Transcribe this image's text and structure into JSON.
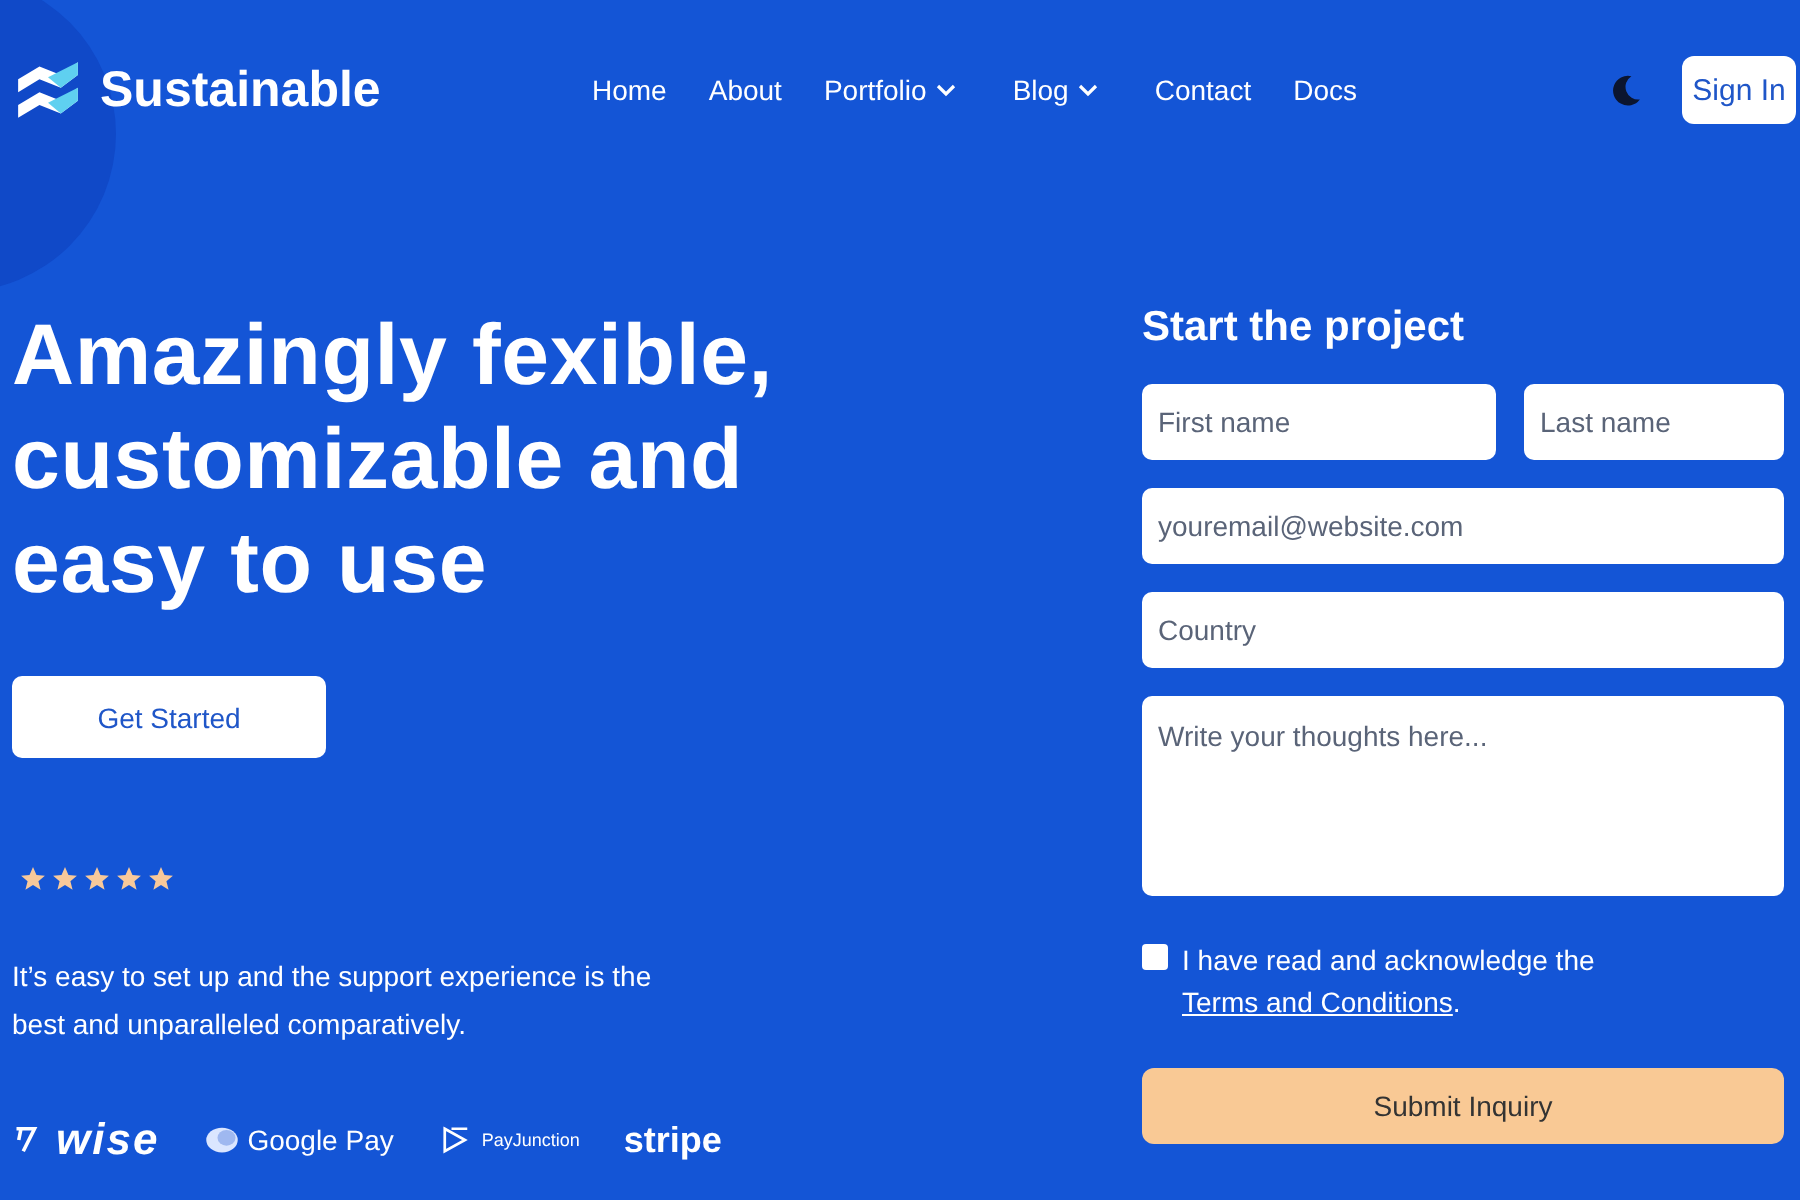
{
  "header": {
    "brand": "Sustainable",
    "nav": [
      {
        "label": "Home",
        "dropdown": false
      },
      {
        "label": "About",
        "dropdown": false
      },
      {
        "label": "Portfolio",
        "dropdown": true
      },
      {
        "label": "Blog",
        "dropdown": true
      },
      {
        "label": "Contact",
        "dropdown": false
      },
      {
        "label": "Docs",
        "dropdown": false
      }
    ],
    "sign_in": "Sign In"
  },
  "hero": {
    "title_lines": [
      "Amazingly fexible,",
      "customizable and",
      "easy to use"
    ],
    "cta": "Get Started",
    "stars": 5,
    "testimonial": "It’s easy to set up and the support experience is the best and unparalleled comparatively.",
    "logos": [
      {
        "kind": "wise",
        "text": "wise"
      },
      {
        "kind": "googlepay",
        "text": "Google Pay"
      },
      {
        "kind": "payjunction",
        "text": "PayJunction"
      },
      {
        "kind": "stripe",
        "text": "stripe"
      }
    ]
  },
  "form": {
    "title": "Start the project",
    "first_name": {
      "placeholder": "First name"
    },
    "last_name": {
      "placeholder": "Last name"
    },
    "email": {
      "placeholder": "youremail@website.com"
    },
    "country": {
      "placeholder": "Country"
    },
    "message": {
      "placeholder": "Write your thoughts here..."
    },
    "consent": {
      "checked": false,
      "text": "I have read and acknowledge the",
      "link": "Terms and Conditions",
      "end": "."
    },
    "submit": "Submit Inquiry"
  }
}
